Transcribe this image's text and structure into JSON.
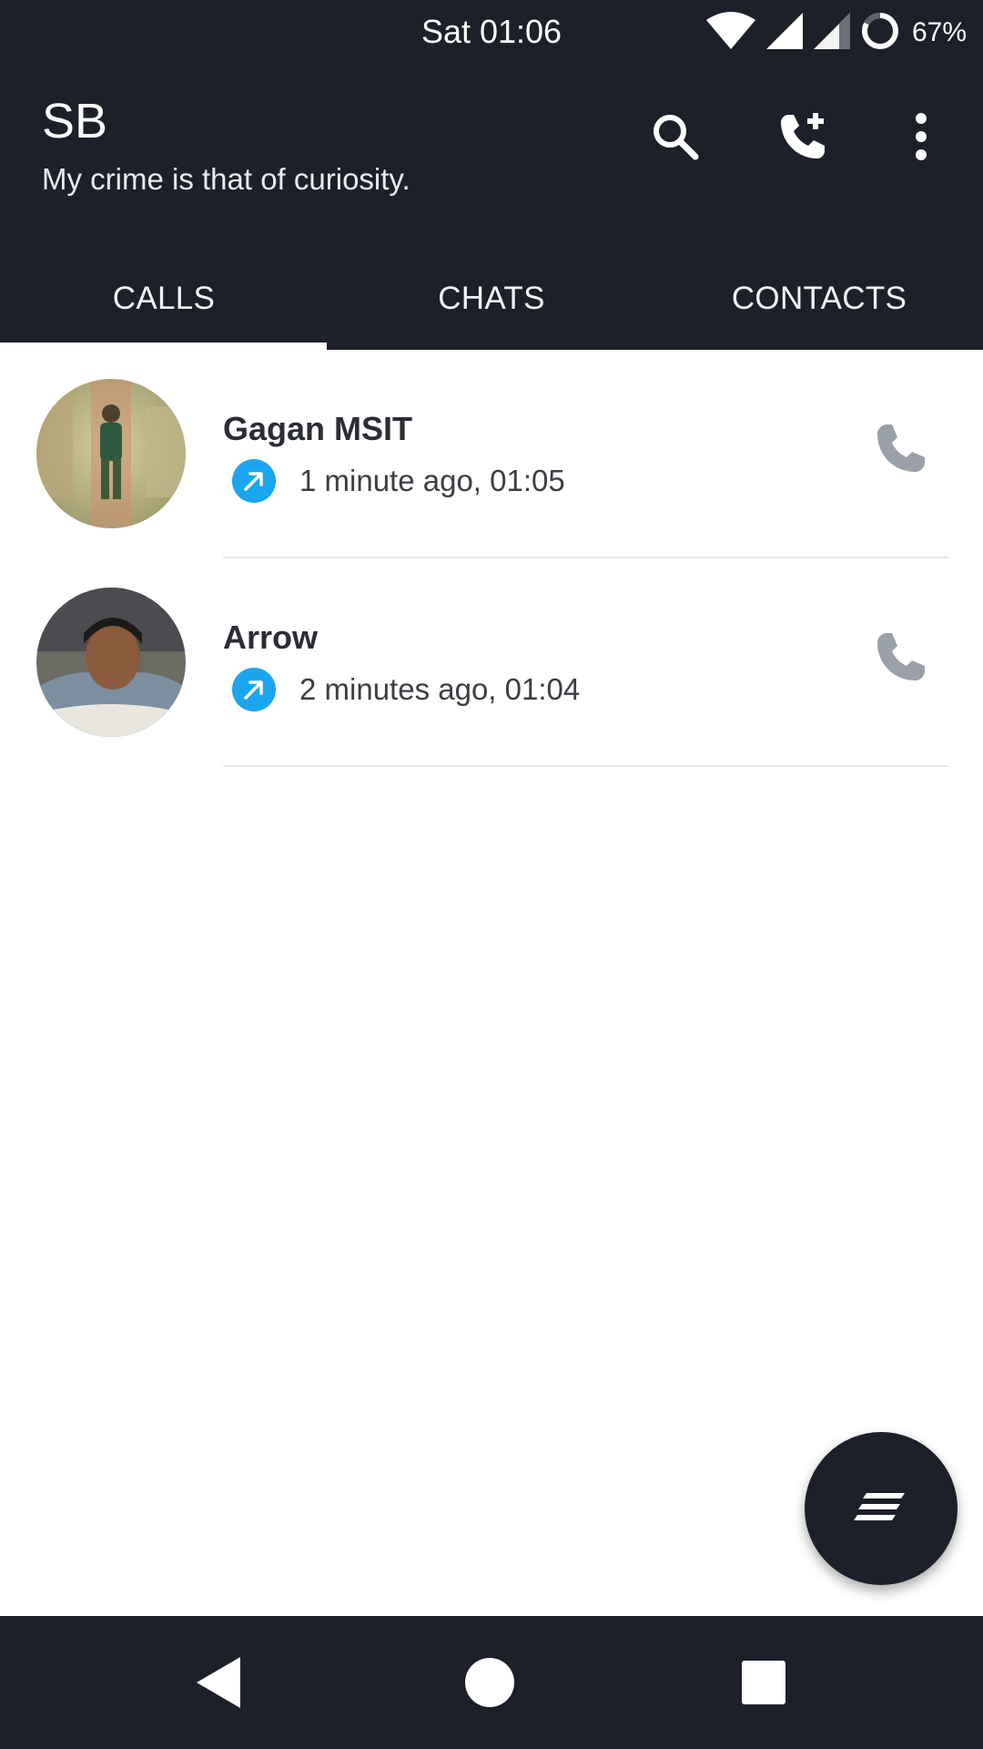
{
  "status_bar": {
    "time": "Sat 01:06",
    "battery": "67%",
    "icons": [
      "wifi-icon",
      "signal-icon",
      "signal-icon",
      "battery-icon"
    ]
  },
  "profile": {
    "name": "SB",
    "status": "My crime is that of curiosity."
  },
  "actions": [
    "search-icon",
    "add-call-icon",
    "more-vert-icon"
  ],
  "tabs": [
    {
      "label": "CALLS",
      "active": true
    },
    {
      "label": "CHATS",
      "active": false
    },
    {
      "label": "CONTACTS",
      "active": false
    }
  ],
  "calls": [
    {
      "name": "Gagan MSIT",
      "time": "1 minute ago, 01:05",
      "direction": "outgoing"
    },
    {
      "name": "Arrow",
      "time": "2 minutes ago, 01:04",
      "direction": "outgoing"
    }
  ],
  "colors": {
    "bar": "#1c2028",
    "outgoing": "#1aa6ee",
    "call_icon": "#9aa0a8"
  },
  "fab_icon": "compose-icon",
  "nav": [
    "back-icon",
    "home-icon",
    "recents-icon"
  ]
}
